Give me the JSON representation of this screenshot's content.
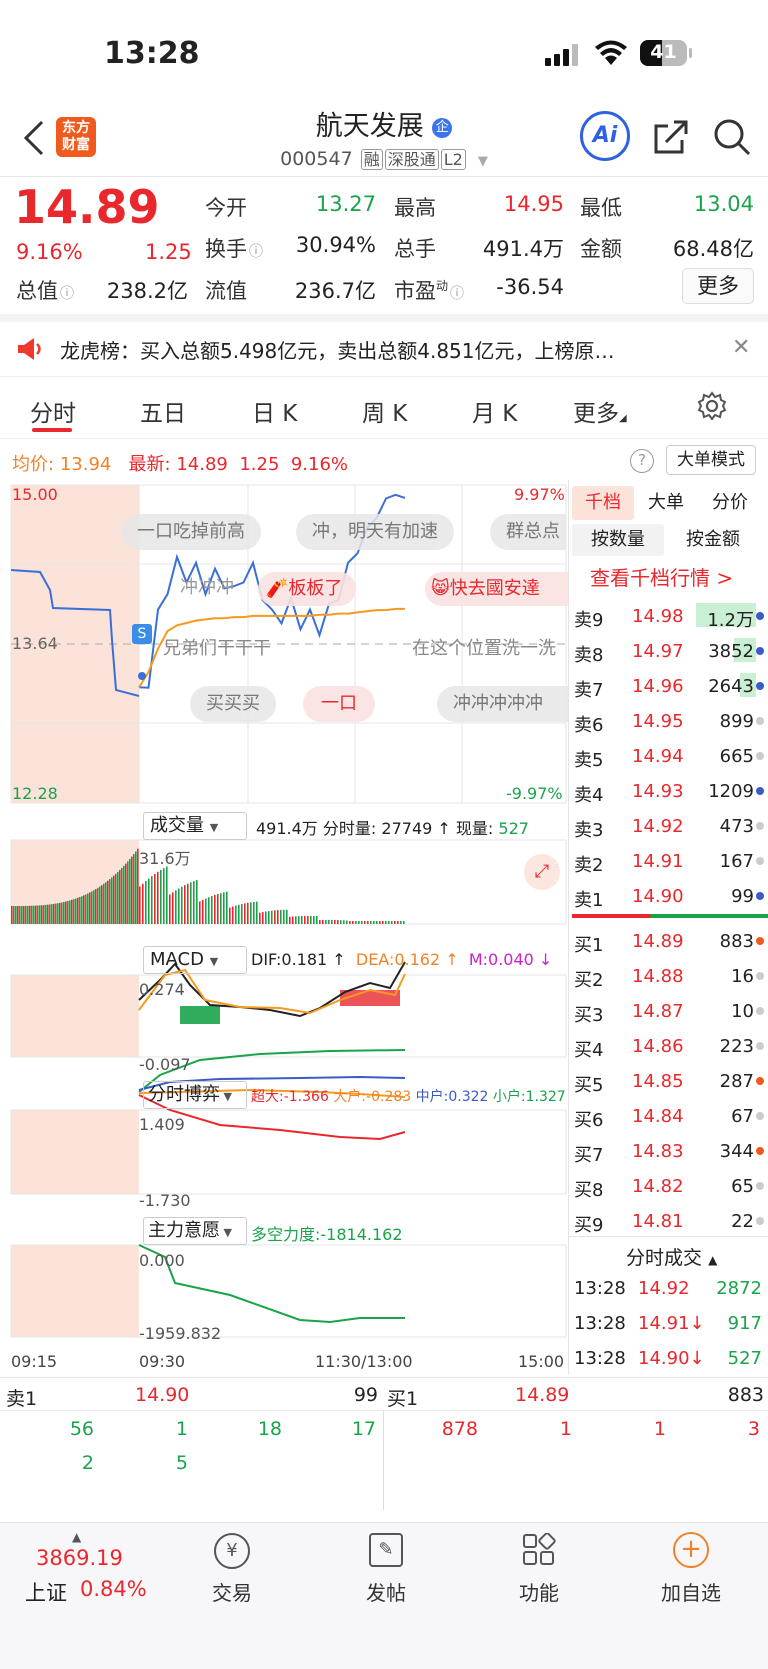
{
  "status": {
    "time": "13:28",
    "battery": "41"
  },
  "header": {
    "brand": [
      "东方",
      "财富"
    ],
    "name": "航天发展",
    "name_tag": "企",
    "code": "000547",
    "tags": [
      "融",
      "深股通",
      "L2"
    ],
    "ai_label": "Ai"
  },
  "quote": {
    "price": "14.89",
    "pct": "9.16%",
    "change": "1.25",
    "open_label": "今开",
    "open": "13.27",
    "high_label": "最高",
    "high": "14.95",
    "low_label": "最低",
    "low": "13.04",
    "turnover_label": "换手",
    "turnover": "30.94%",
    "volume_label": "总手",
    "volume": "491.4万",
    "amount_label": "金额",
    "amount": "68.48亿",
    "mcap_label": "总值",
    "mcap": "238.2亿",
    "float_label": "流值",
    "float": "236.7亿",
    "pe_label": "市盈",
    "pe_sup": "动",
    "pe": "-36.54",
    "more": "更多"
  },
  "notice": {
    "text": "龙虎榜：买入总额5.498亿元，卖出总额4.851亿元，上榜原…"
  },
  "tabs": [
    "分时",
    "五日",
    "日 K",
    "周 K",
    "月 K",
    "更多"
  ],
  "avgline": {
    "avg_label": "均价:",
    "avg": "13.94",
    "latest_label": "最新:",
    "latest": "14.89",
    "chg": "1.25",
    "pct": "9.16%",
    "big_order_mode": "大单模式"
  },
  "chart_data": {
    "type": "line",
    "x_ticks": [
      "09:15",
      "09:30",
      "11:30/13:00",
      "15:00"
    ],
    "ylim": [
      12.28,
      15.0
    ],
    "y_left_top": "15.00",
    "y_left_mid": "13.64",
    "y_left_bottom": "12.28",
    "y_right_top": "9.97%",
    "y_right_bottom": "-9.97%",
    "price_series": [
      13.27,
      13.3,
      13.9,
      14.1,
      14.35,
      14.2,
      14.3,
      14.1,
      14.25,
      14.15,
      14.1,
      14.2,
      14.3,
      14.05,
      13.9,
      13.85,
      14.0,
      13.8,
      13.9,
      13.75,
      13.95,
      14.05,
      14.3,
      14.45,
      14.6,
      14.75,
      14.85,
      14.95,
      14.89
    ],
    "avg_series": [
      13.27,
      13.4,
      13.6,
      13.75,
      13.8,
      13.82,
      13.84,
      13.85,
      13.86,
      13.86,
      13.87,
      13.87,
      13.88,
      13.88,
      13.88,
      13.88,
      13.88,
      13.88,
      13.88,
      13.89,
      13.89,
      13.9,
      13.9,
      13.91,
      13.92,
      13.93,
      13.93,
      13.94,
      13.94
    ]
  },
  "danmaku": [
    "一口吃掉前高",
    "冲，明天有加速",
    "群总点",
    "冲冲冲",
    "板板了",
    "快去國安達",
    "兄弟们干干干",
    "在这个位置洗一洗",
    "买买买",
    "一口",
    "冲冲冲冲冲"
  ],
  "volume_panel": {
    "selector": "成交量",
    "total": "491.4万",
    "min_vol_label": "分时量:",
    "min_vol": "27749",
    "cur_label": "现量:",
    "cur": "527",
    "max": "31.6万"
  },
  "macd_panel": {
    "selector": "MACD",
    "dif": "DIF:0.181",
    "dea": "DEA:0.162",
    "m": "M:0.040",
    "top": "0.274",
    "bottom": "-0.097"
  },
  "game_panel": {
    "selector": "分时博弈",
    "super": "超大:-1.366",
    "big": "大户:-0.283",
    "mid": "中户:0.322",
    "small": "小户:1.327",
    "top": "1.409",
    "bottom": "-1.730"
  },
  "will_panel": {
    "selector": "主力意愿",
    "force": "多空力度:-1814.162",
    "top": "0.000",
    "bottom": "-1959.832"
  },
  "orderbook": {
    "tabs": [
      "千档",
      "大单",
      "分价"
    ],
    "subtabs": [
      "按数量",
      "按金额"
    ],
    "link": "查看千档行情 >",
    "asks": [
      {
        "label": "卖9",
        "price": "14.98",
        "vol": "1.2万"
      },
      {
        "label": "卖8",
        "price": "14.97",
        "vol": "3852"
      },
      {
        "label": "卖7",
        "price": "14.96",
        "vol": "2643"
      },
      {
        "label": "卖6",
        "price": "14.95",
        "vol": "899"
      },
      {
        "label": "卖5",
        "price": "14.94",
        "vol": "665"
      },
      {
        "label": "卖4",
        "price": "14.93",
        "vol": "1209"
      },
      {
        "label": "卖3",
        "price": "14.92",
        "vol": "473"
      },
      {
        "label": "卖2",
        "price": "14.91",
        "vol": "167"
      },
      {
        "label": "卖1",
        "price": "14.90",
        "vol": "99"
      }
    ],
    "bids": [
      {
        "label": "买1",
        "price": "14.89",
        "vol": "883"
      },
      {
        "label": "买2",
        "price": "14.88",
        "vol": "16"
      },
      {
        "label": "买3",
        "price": "14.87",
        "vol": "10"
      },
      {
        "label": "买4",
        "price": "14.86",
        "vol": "223"
      },
      {
        "label": "买5",
        "price": "14.85",
        "vol": "287"
      },
      {
        "label": "买6",
        "price": "14.84",
        "vol": "67"
      },
      {
        "label": "买7",
        "price": "14.83",
        "vol": "344"
      },
      {
        "label": "买8",
        "price": "14.82",
        "vol": "65"
      },
      {
        "label": "买9",
        "price": "14.81",
        "vol": "22"
      }
    ],
    "trades_title": "分时成交",
    "trades": [
      {
        "time": "13:28",
        "price": "14.92",
        "vol": "2872"
      },
      {
        "time": "13:28",
        "price": "14.91↓",
        "vol": "917"
      },
      {
        "time": "13:28",
        "price": "14.90↓",
        "vol": "527"
      }
    ]
  },
  "queue": {
    "sell_label": "卖1",
    "sell_price": "14.90",
    "sell_total": "99",
    "buy_label": "买1",
    "buy_price": "14.89",
    "buy_total": "883",
    "sell_orders": [
      "56",
      "1",
      "18",
      "17",
      "2",
      "5"
    ],
    "buy_orders": [
      "878",
      "1",
      "1",
      "3"
    ]
  },
  "bottom_nav": {
    "index_value": "3869.19",
    "index_name": "上证",
    "index_pct": "0.84%",
    "items": [
      "交易",
      "发帖",
      "功能",
      "加自选"
    ]
  }
}
